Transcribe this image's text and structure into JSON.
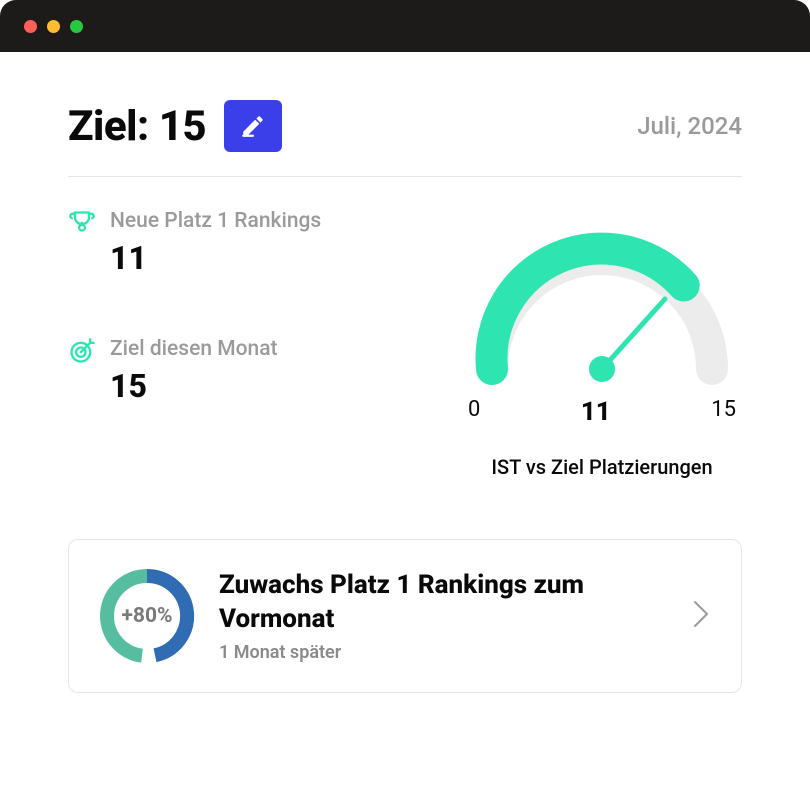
{
  "header": {
    "goal_title": "Ziel: 15",
    "date_label": "Juli, 2024"
  },
  "stats": {
    "new_rankings": {
      "label": "Neue Platz 1 Rankings",
      "value": "11"
    },
    "month_goal": {
      "label": "Ziel diesen Monat",
      "value": "15"
    }
  },
  "gauge": {
    "min": "0",
    "current": "11",
    "max": "15",
    "caption": "IST vs Ziel Platzierungen"
  },
  "growth": {
    "percent": "+80%",
    "title": "Zuwachs Platz 1 Rankings zum Vormonat",
    "subtitle": "1 Monat später"
  },
  "chart_data": [
    {
      "type": "gauge",
      "title": "IST vs Ziel Platzierungen",
      "min": 0,
      "max": 15,
      "value": 11,
      "series": [
        {
          "name": "IST",
          "values": [
            11
          ]
        },
        {
          "name": "Ziel",
          "values": [
            15
          ]
        }
      ]
    },
    {
      "type": "pie",
      "title": "Zuwachs Platz 1 Rankings zum Vormonat",
      "center_label": "+80%",
      "series": [
        {
          "name": "segment-blue",
          "color": "#2f6cb3",
          "values": [
            55
          ]
        },
        {
          "name": "segment-teal",
          "color": "#56bda0",
          "values": [
            45
          ]
        }
      ]
    }
  ]
}
